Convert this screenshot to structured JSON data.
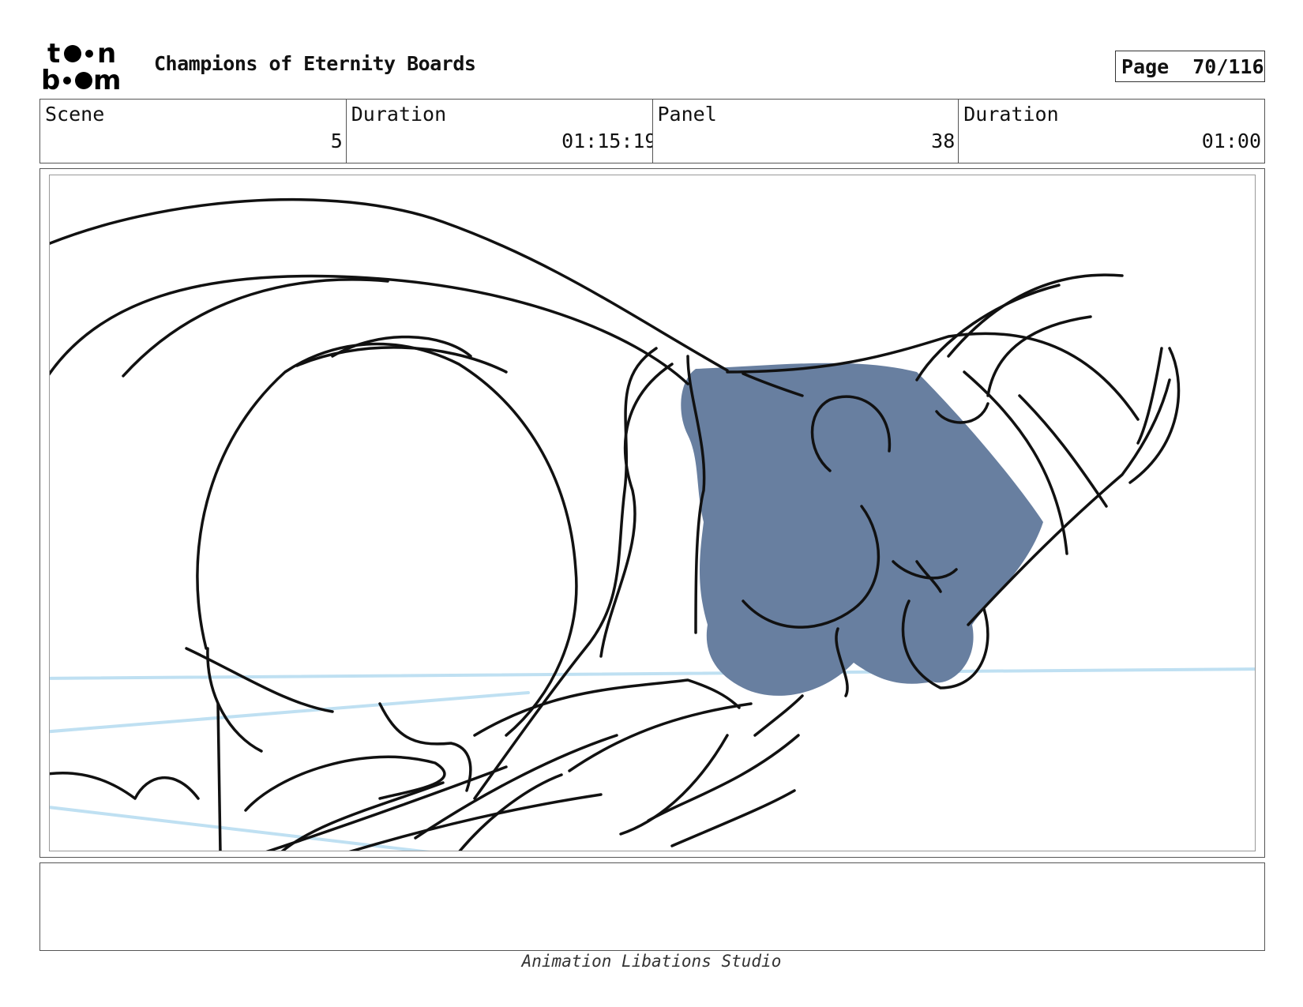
{
  "logo": {
    "line1": "toon",
    "line2": "boom"
  },
  "header": {
    "title": "Champions of Eternity Boards",
    "page_label": "Page",
    "page_value": "70/116"
  },
  "info": [
    {
      "label": "Scene",
      "value": "5"
    },
    {
      "label": "Duration",
      "value": "01:15:19"
    },
    {
      "label": "Panel",
      "value": "38"
    },
    {
      "label": "Duration",
      "value": "01:00"
    }
  ],
  "notes": {
    "text": ""
  },
  "footer": {
    "studio": "Animation Libations Studio"
  },
  "colors": {
    "sketch_fill": "#687fa0",
    "guide_line": "#bfe0f2",
    "ink": "#111111"
  }
}
